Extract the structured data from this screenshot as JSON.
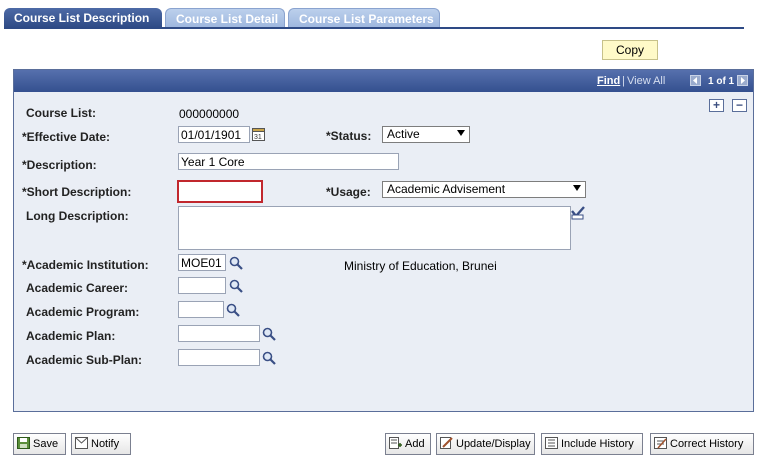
{
  "tabs": [
    {
      "label": "Course List Description"
    },
    {
      "label": "Course List Detail"
    },
    {
      "label": "Course List Parameters"
    }
  ],
  "copy_button": "Copy",
  "panel": {
    "find": "Find",
    "separator": "|",
    "view_all": "View All",
    "count": "1 of 1"
  },
  "form": {
    "course_list": {
      "label": "Course List:",
      "value": "000000000"
    },
    "effective_date": {
      "label": "*Effective Date:",
      "value": "01/01/1901"
    },
    "status": {
      "label": "*Status:",
      "value": "Active"
    },
    "description": {
      "label": "*Description:",
      "value": "Year 1 Core"
    },
    "short_description": {
      "label": "*Short Description:",
      "value": ""
    },
    "usage": {
      "label": "*Usage:",
      "value": "Academic Advisement"
    },
    "long_description": {
      "label": "Long Description:",
      "value": ""
    },
    "academic_institution": {
      "label": "*Academic Institution:",
      "value": "MOE01",
      "description": "Ministry of Education, Brunei"
    },
    "academic_career": {
      "label": "Academic Career:",
      "value": ""
    },
    "academic_program": {
      "label": "Academic Program:",
      "value": ""
    },
    "academic_plan": {
      "label": "Academic Plan:",
      "value": ""
    },
    "academic_subplan": {
      "label": "Academic Sub-Plan:",
      "value": ""
    }
  },
  "bottom_buttons": {
    "save": "Save",
    "notify": "Notify",
    "add": "Add",
    "update_display": "Update/Display",
    "include_history": "Include History",
    "correct_history": "Correct History"
  },
  "colors": {
    "tab_active": "#2e4a85",
    "panel_header": "#3f5a9c",
    "panel_bg": "#eaeef5",
    "copy_button_bg": "#fffac8",
    "required_highlight": "#c1272d"
  }
}
